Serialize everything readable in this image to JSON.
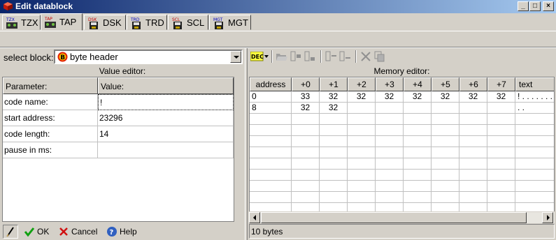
{
  "window": {
    "title": "Edit datablock",
    "controls": [
      "_",
      "□",
      "×"
    ]
  },
  "tabs": [
    {
      "label": "TZX",
      "icon": "tzx-tape-icon",
      "badge": "TZX"
    },
    {
      "label": "TAP",
      "icon": "tap-tape-icon",
      "badge": "TAP",
      "active": true
    },
    {
      "label": "DSK",
      "icon": "dsk-floppy-icon",
      "badge": "DSK"
    },
    {
      "label": "TRD",
      "icon": "trd-floppy-icon",
      "badge": "TRD"
    },
    {
      "label": "SCL",
      "icon": "scl-floppy-icon",
      "badge": "SCL"
    },
    {
      "label": "MGT",
      "icon": "mgt-floppy-icon",
      "badge": "MGT"
    }
  ],
  "left": {
    "select_label": "select block:",
    "selected_block": "byte header",
    "block_badge": "B",
    "value_editor_title": "Value editor:",
    "columns": [
      "Parameter:",
      "Value:"
    ],
    "rows": [
      {
        "param": "code name:",
        "value": "!"
      },
      {
        "param": "start address:",
        "value": "23296"
      },
      {
        "param": "code length:",
        "value": "14"
      },
      {
        "param": "pause in ms:",
        "value": ""
      }
    ],
    "ok_label": "OK",
    "cancel_label": "Cancel",
    "help_label": "Help"
  },
  "right": {
    "dec_label": "DEC",
    "memory_title": "Memory editor:",
    "columns": [
      "address",
      "+0",
      "+1",
      "+2",
      "+3",
      "+4",
      "+5",
      "+6",
      "+7",
      "text"
    ],
    "rows": [
      [
        "0",
        "33",
        "32",
        "32",
        "32",
        "32",
        "32",
        "32",
        "32",
        "! . . . . . . ."
      ],
      [
        "8",
        "32",
        "32",
        "",
        "",
        "",
        "",
        "",
        "",
        ". ."
      ]
    ],
    "status": "10 bytes"
  },
  "colors": {
    "title_start": "#0a246a",
    "title_end": "#a6caf0",
    "face": "#d4d0c8"
  }
}
